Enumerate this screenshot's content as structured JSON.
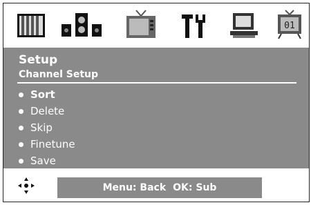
{
  "icons": [
    "picture-icon",
    "sound-icon",
    "tv-icon",
    "tools-icon",
    "computer-icon",
    "channel-icon"
  ],
  "channel_icon_text": "01",
  "panel": {
    "title": "Setup",
    "subtitle": "Channel Setup",
    "items": [
      {
        "label": "Sort",
        "active": true
      },
      {
        "label": "Delete",
        "active": false
      },
      {
        "label": "Skip",
        "active": false
      },
      {
        "label": "Finetune",
        "active": false
      },
      {
        "label": "Save",
        "active": false
      }
    ]
  },
  "footer": {
    "menu_hint": "Menu: Back",
    "ok_hint": "OK: Sub"
  },
  "colors": {
    "panel_bg": "#8a8a8a",
    "text": "#ffffff"
  }
}
